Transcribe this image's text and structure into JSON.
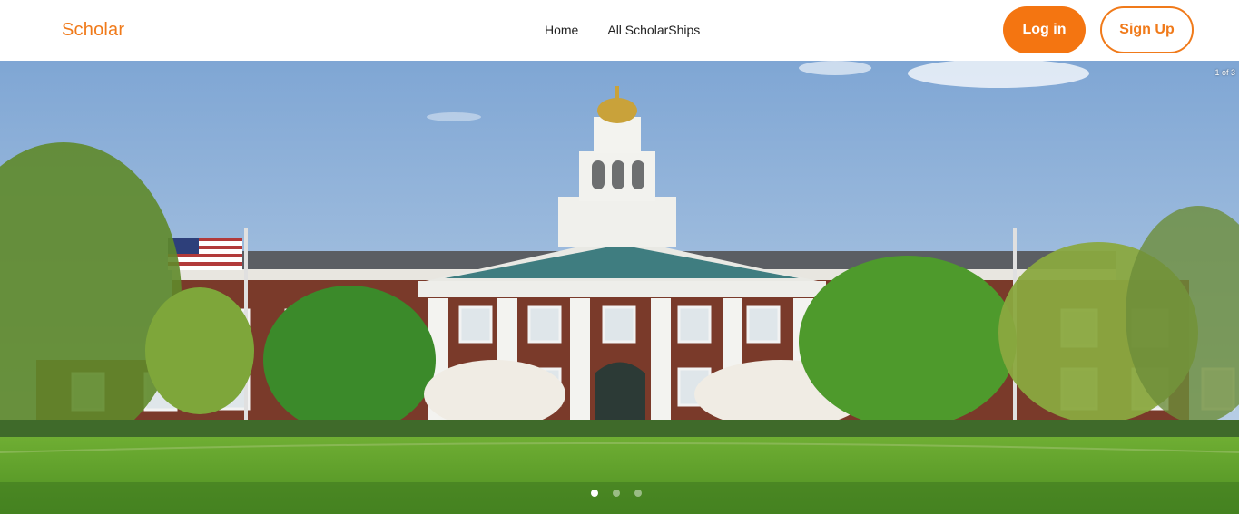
{
  "navbar": {
    "brand": "Scholar",
    "links": [
      {
        "label": "Home"
      },
      {
        "label": "All ScholarShips"
      }
    ],
    "login_label": "Log in",
    "signup_label": "Sign Up"
  },
  "colors": {
    "accent": "#f47511",
    "nav_text": "#222222",
    "background": "#ffffff"
  },
  "hero": {
    "image_alt": "Campus building with clock tower",
    "slide_counter": "1 of 3",
    "active_slide": 1,
    "total_slides": 3
  }
}
